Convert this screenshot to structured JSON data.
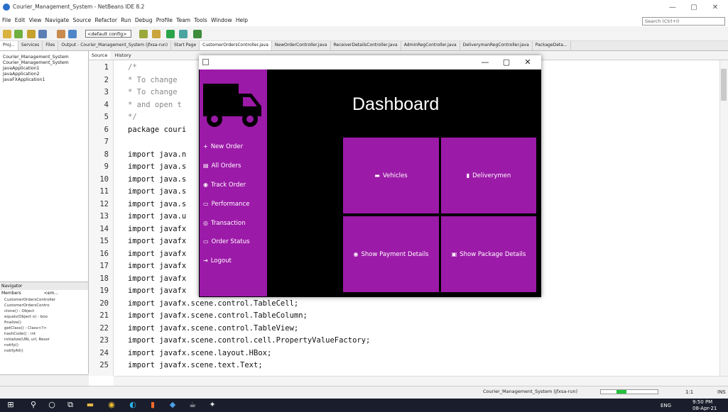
{
  "window": {
    "title": "Courier_Management_System - NetBeans IDE 8.2",
    "minimize": "—",
    "maximize": "▢",
    "close": "✕"
  },
  "menu": [
    "File",
    "Edit",
    "View",
    "Navigate",
    "Source",
    "Refactor",
    "Run",
    "Debug",
    "Profile",
    "Team",
    "Tools",
    "Window",
    "Help"
  ],
  "search": {
    "placeholder": "Search (Ctrl+I)"
  },
  "toolbar": {
    "config": "<default config>"
  },
  "tabs": [
    {
      "label": "Proj...",
      "active": true
    },
    {
      "label": "Services"
    },
    {
      "label": "Files"
    },
    {
      "label": "Output - Courier_Management_System (jfxsa-run)"
    },
    {
      "label": "Source",
      "active": true
    },
    {
      "label": "History"
    },
    {
      "label": "Start Page"
    },
    {
      "label": "CustomerOrdersController.java",
      "active": true
    },
    {
      "label": "NewOrderController.java"
    },
    {
      "label": "ReceiverDetailsController.java"
    },
    {
      "label": "AdminRegController.java"
    },
    {
      "label": "DeliverymanRegController.java"
    },
    {
      "label": "PackageDeta..."
    }
  ],
  "project_tree": [
    "Courier_Management_System",
    "Courier_Management_System",
    "JavaApplication1",
    "JavaApplication2",
    "JavaFXApplication1"
  ],
  "navigator": {
    "title": "Navigator",
    "members": "Members",
    "filter": "<em...",
    "items": [
      "CustomerOrdersController",
      "CustomerOrdersContro",
      "clone() : Object",
      "equals(Object o) : boo",
      "finalize()",
      "getClass() : Class<?>",
      "hashCode() : int",
      "initialize(URL url, Resor",
      "notify()",
      "notifyAll()"
    ]
  },
  "code_lines": [
    {
      "n": "1",
      "t": "/*"
    },
    {
      "n": "2",
      "t": " * To change"
    },
    {
      "n": "3",
      "t": " * To change"
    },
    {
      "n": "4",
      "t": " * and open t"
    },
    {
      "n": "5",
      "t": " */"
    },
    {
      "n": "6",
      "t": "package couri"
    },
    {
      "n": "7",
      "t": ""
    },
    {
      "n": "8",
      "t": "import java.n"
    },
    {
      "n": "9",
      "t": "import java.s"
    },
    {
      "n": "10",
      "t": "import java.s"
    },
    {
      "n": "11",
      "t": "import java.s"
    },
    {
      "n": "12",
      "t": "import java.s"
    },
    {
      "n": "13",
      "t": "import java.u"
    },
    {
      "n": "14",
      "t": "import javafx"
    },
    {
      "n": "15",
      "t": "import javafx"
    },
    {
      "n": "16",
      "t": "import javafx"
    },
    {
      "n": "17",
      "t": "import javafx"
    },
    {
      "n": "18",
      "t": "import javafx"
    },
    {
      "n": "19",
      "t": "import javafx"
    },
    {
      "n": "20",
      "t": "import javafx.scene.control.TableCell;"
    },
    {
      "n": "21",
      "t": "import javafx.scene.control.TableColumn;"
    },
    {
      "n": "22",
      "t": "import javafx.scene.control.TableView;"
    },
    {
      "n": "23",
      "t": "import javafx.scene.control.cell.PropertyValueFactory;"
    },
    {
      "n": "24",
      "t": "import javafx.scene.layout.HBox;"
    },
    {
      "n": "25",
      "t": "import javafx.scene.text.Text;"
    }
  ],
  "status": {
    "project": "Courier_Management_System (jfxsa-run)",
    "cursor": "1:1",
    "mode": "INS",
    "progress": 0.4
  },
  "taskbar": {
    "time": "9:50 PM",
    "date": "08-Apr-21",
    "lang": "ENG"
  },
  "dashboard": {
    "title": "Dashboard",
    "nav": [
      "New Order",
      "All Orders",
      "Track Order",
      "Performance",
      "Transaction",
      "Order Status",
      "Logout"
    ],
    "tiles": [
      "Vehicles",
      "Deliverymen",
      "Show Payment Details",
      "Show Package Details"
    ],
    "colors": {
      "accent": "#9c1aa8",
      "background": "#000000"
    }
  }
}
